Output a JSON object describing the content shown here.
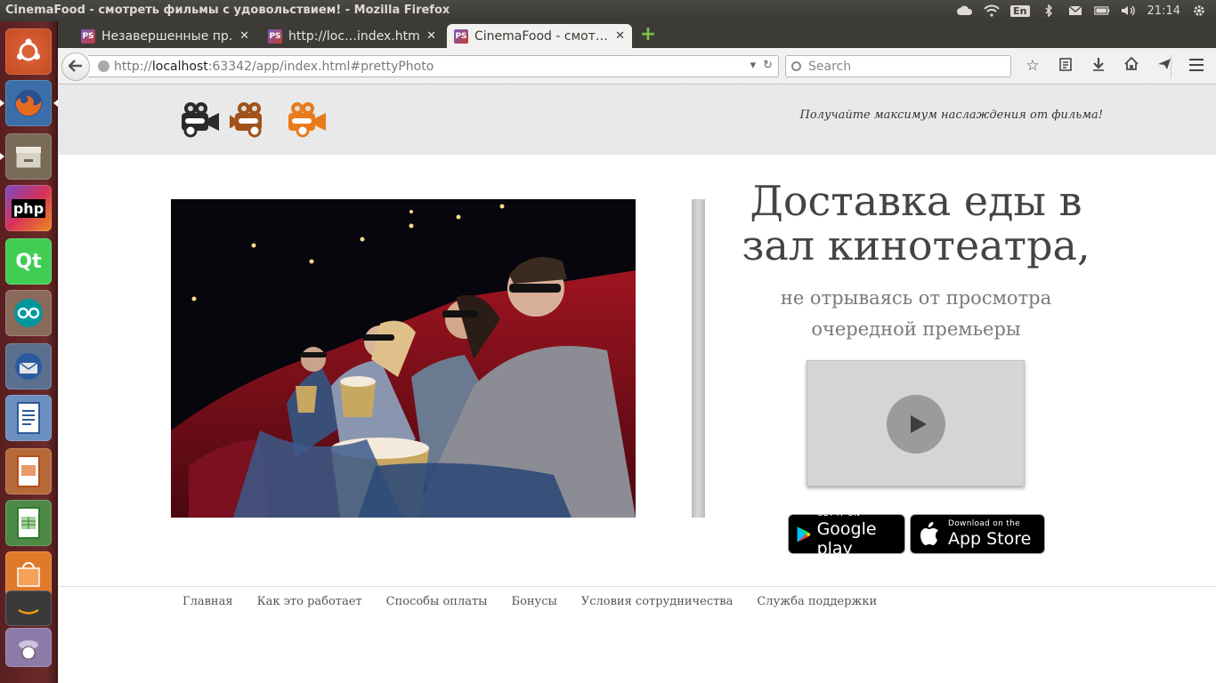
{
  "system": {
    "window_title": "CinemaFood - смотреть фильмы с удовольствием! - Mozilla Firefox",
    "keyboard_layout": "En",
    "clock": "21:14"
  },
  "launcher": {
    "apps": [
      "ubuntu-dash",
      "firefox",
      "file-manager",
      "phpstorm",
      "qt-creator",
      "arduino",
      "thunderbird",
      "libreoffice-writer",
      "libreoffice-impress",
      "libreoffice-calc",
      "ubuntu-software-center",
      "amazon",
      "trash"
    ],
    "php_label": "php",
    "qt_label": "Qt"
  },
  "browser": {
    "tabs": [
      {
        "title": "Незавершенные пр…",
        "close": "✕",
        "favicon_text": "PS"
      },
      {
        "title": "http://loc…index.html",
        "close": "✕",
        "favicon_text": "PS"
      },
      {
        "title": "CinemaFood - смот…",
        "close": "✕",
        "favicon_text": "PS",
        "active": true
      }
    ],
    "new_tab": "+",
    "url": {
      "prefix": "http://",
      "host": "localhost",
      "rest": ":63342/app/index.html#prettyPhoto"
    },
    "search_placeholder": "Search"
  },
  "site": {
    "tagline": "Получайте максимум наслаждения от фильма!",
    "headline_line1": "Доставка еды в",
    "headline_line2": "зал кинотеатра,",
    "subline_line1": "не отрываясь от просмотра",
    "subline_line2": "очередной премьеры",
    "google_play": {
      "small": "GET IT ON",
      "big": "Google play"
    },
    "app_store": {
      "small": "Download on the",
      "big": "App Store"
    },
    "footer_links": [
      "Главная",
      "Как это работает",
      "Способы оплаты",
      "Бонусы",
      "Условия сотрудничества",
      "Служба поддержки"
    ]
  },
  "colors": {
    "launcher": "#6b2a2a",
    "panel": "#3c3b37",
    "logo_dark": "#2a2a2a",
    "logo_brown": "#a0521a",
    "logo_orange": "#e87b1c",
    "video_bg": "#d5d5d5"
  }
}
